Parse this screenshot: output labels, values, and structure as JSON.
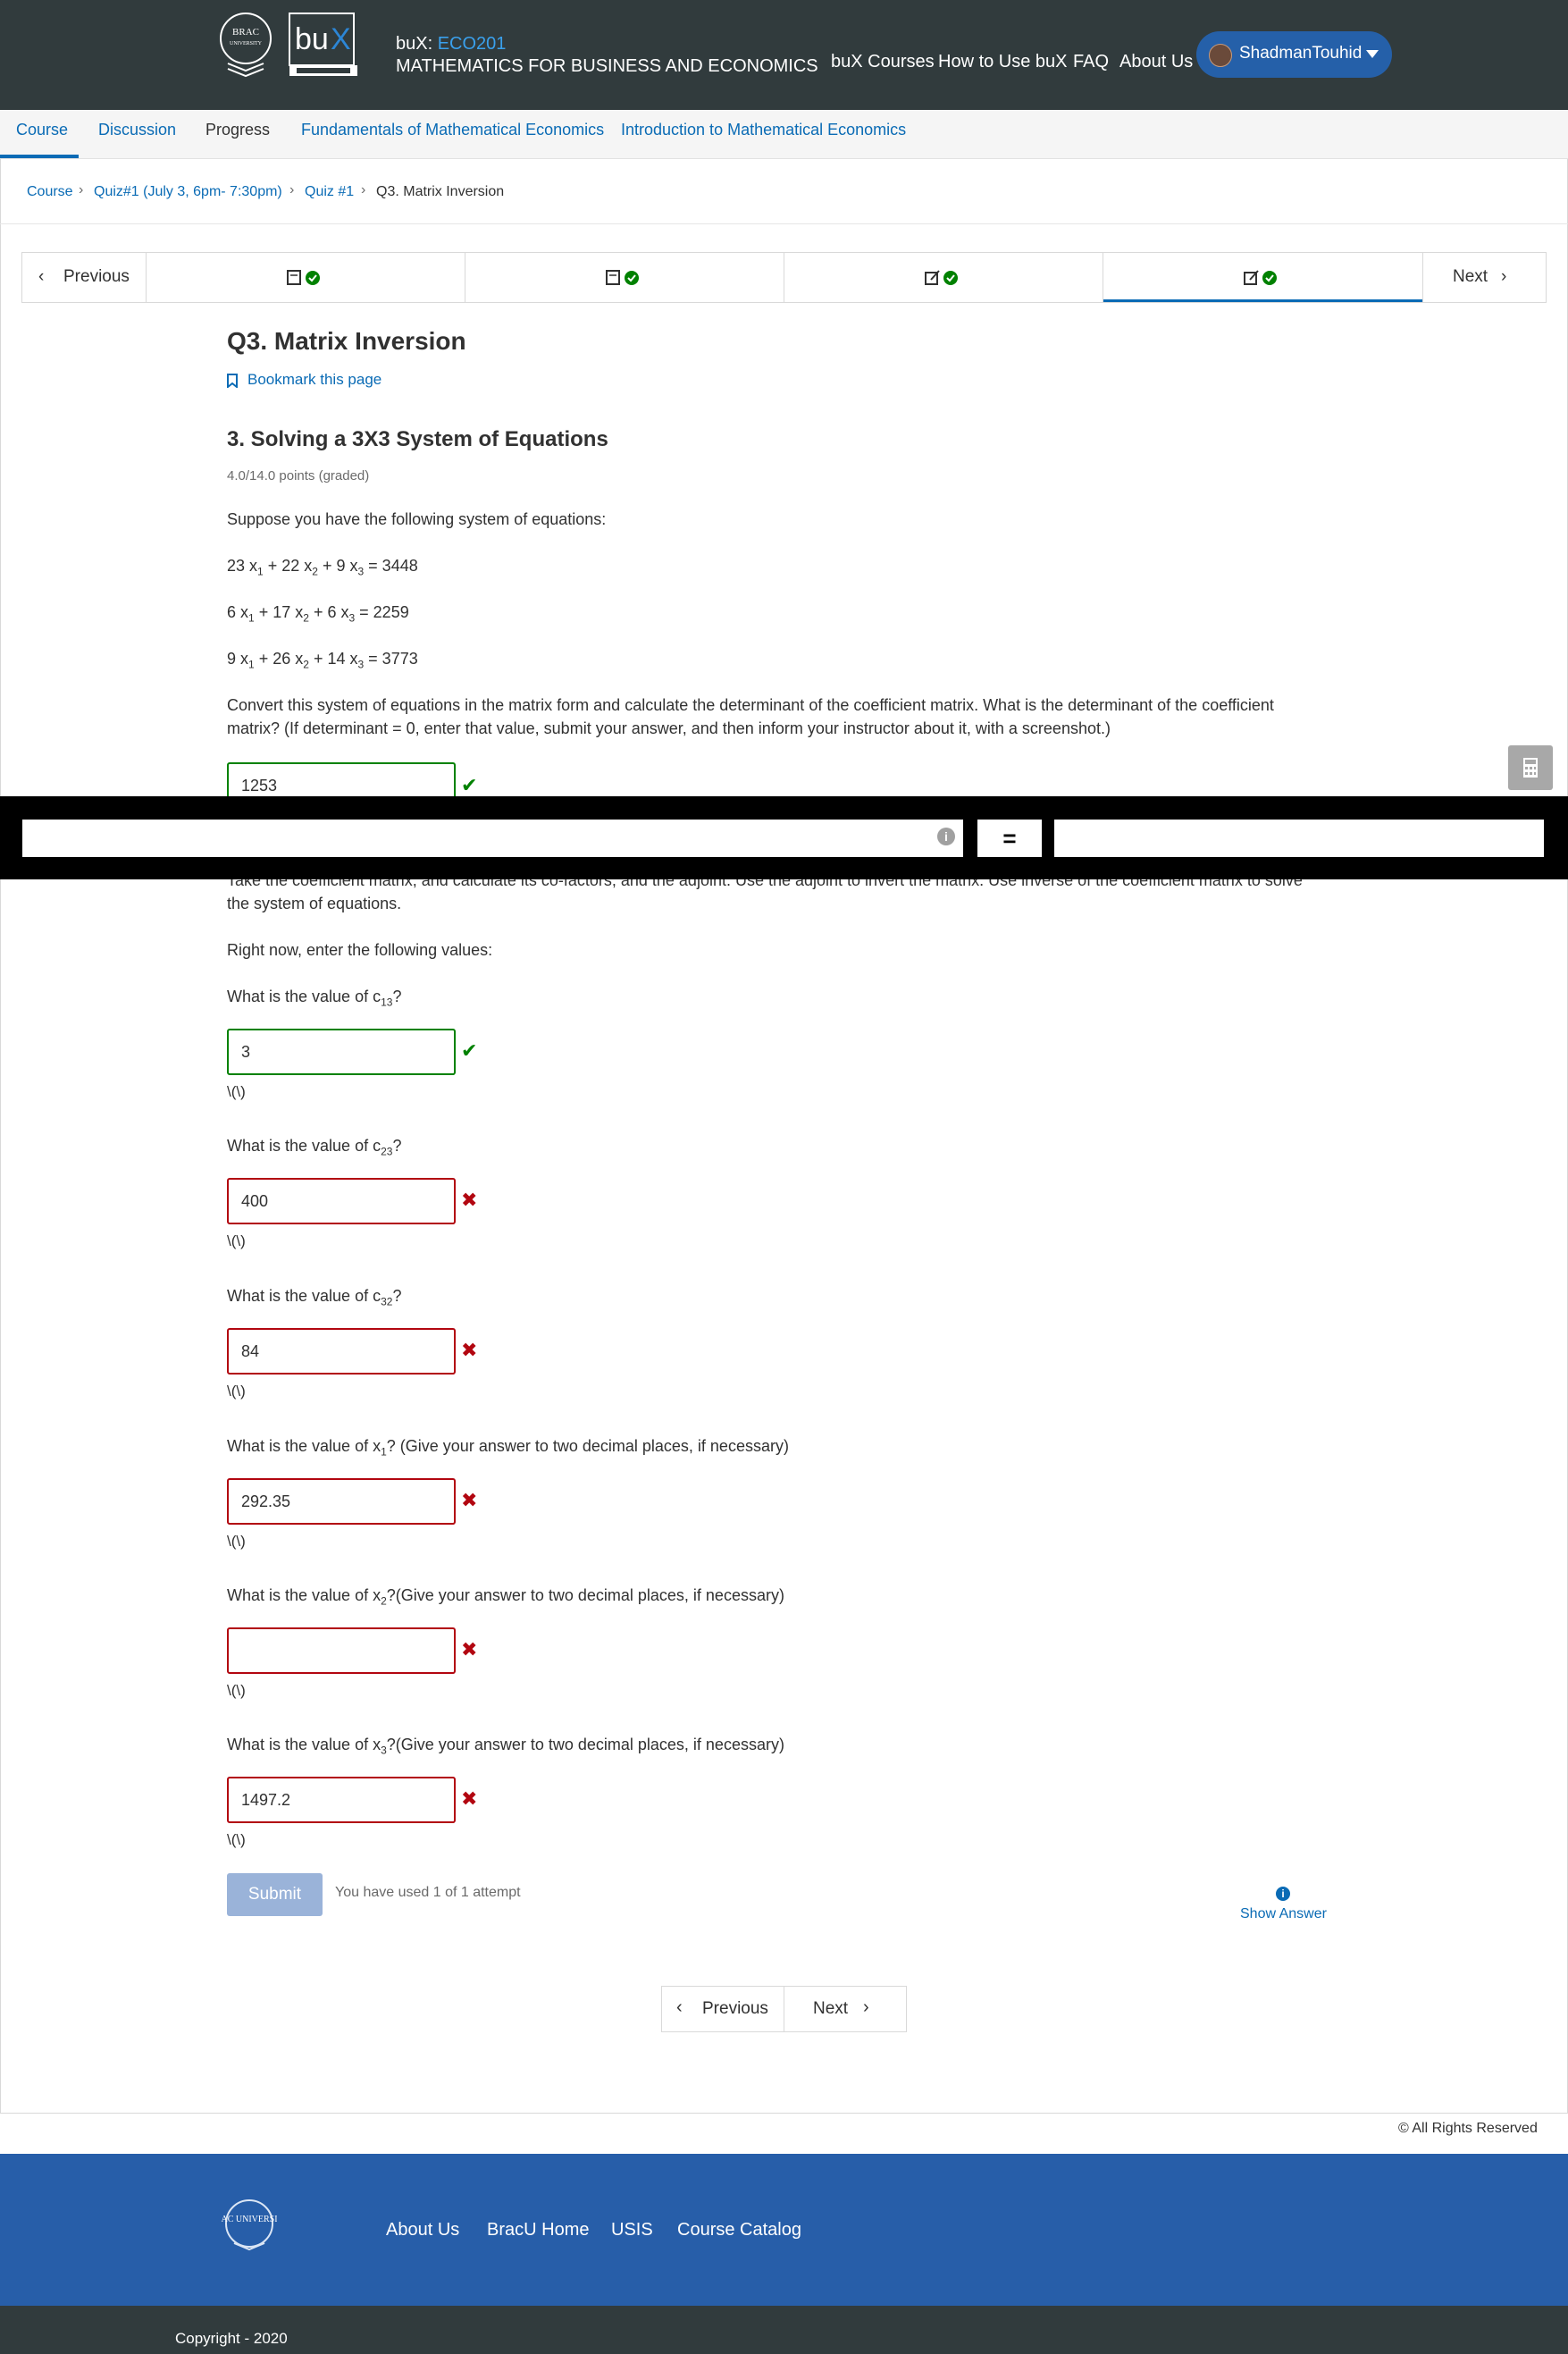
{
  "header": {
    "org_prefix": "buX: ",
    "course_code": "ECO201",
    "course_title": "MATHEMATICS FOR BUSINESS AND ECONOMICS",
    "nav": [
      "buX Courses",
      "How to Use buX",
      "FAQ",
      "About Us"
    ],
    "user_name": "ShadmanTouhid",
    "logo_brac_text": "BRAC UNIVERSITY",
    "logo_bux_text": "buX"
  },
  "course_tabs": [
    "Course",
    "Discussion",
    "Progress",
    "Fundamentals of Mathematical Economics",
    "Introduction to Mathematical Economics"
  ],
  "breadcrumb": [
    "Course",
    "Quiz#1 (July 3, 6pm- 7:30pm)",
    "Quiz #1",
    "Q3. Matrix Inversion"
  ],
  "sequence": {
    "previous": "Previous",
    "next": "Next"
  },
  "problem": {
    "unit_title": "Q3. Matrix Inversion",
    "bookmark": "Bookmark this page",
    "title": "3. Solving a 3X3 System of Equations",
    "points": "4.0/14.0 points (graded)",
    "intro": "Suppose you have the following system of equations:",
    "eq1": {
      "a": "23 x",
      "b": " + 22 x",
      "c": " + 9 x",
      "rhs": " = 3448"
    },
    "eq2": {
      "a": "6 x",
      "b": " + 17 x",
      "c": " + 6 x",
      "rhs": " = 2259"
    },
    "eq3": {
      "a": "9 x",
      "b": " + 26 x",
      "c": " + 14 x",
      "rhs": " = 3773"
    },
    "det_question_line1": "Convert this system of equations in the matrix form and calculate the determinant of the coefficient matrix. What is the determinant of the coefficient",
    "det_question_line2": "matrix? (If determinant = 0, enter that value, submit your answer, and then inform your instructor about it, with a screenshot.)",
    "det_answer": "1253",
    "cofactor_instr_line1": "Take the coefficient matrix, and calculate its co-factors, and the adjoint. Use the adjoint to invert the matrix. Use inverse of the coefficient matrix to solve",
    "cofactor_instr_line2": "the system of equations.",
    "right_now": "Right now, enter the following values:",
    "q_c13_pre": "What is the value of c",
    "q_c13_sub": "13",
    "q_c23_sub": "23",
    "q_c32_sub": "32",
    "q_suffix": "?",
    "ans_c13": "3",
    "ans_c23": "400",
    "ans_c32": "84",
    "q_x1_pre": "What is the value of x",
    "q_x1_post": "? (Give your answer to two decimal places, if necessary)",
    "q_x2_post": "?(Give your answer to two decimal places, if necessary)",
    "q_x3_post": "?(Give your answer to two decimal places, if necessary)",
    "ans_x1": "292.35",
    "ans_x2": "",
    "ans_x3": "1497.2",
    "mathjax_placeholder": "\\(\\)",
    "sub1": "1",
    "sub2": "2",
    "sub3": "3",
    "submit": "Submit",
    "attempts": "You have used 1 of 1 attempt",
    "show_answer": "Show Answer"
  },
  "calculator": {
    "equals": "="
  },
  "rights": "© All Rights Reserved",
  "footer": {
    "links": [
      "About Us",
      "BracU Home",
      "USIS",
      "Course Catalog"
    ],
    "copyright": "Copyright - 2020"
  },
  "colors": {
    "header_bg": "#313b3d",
    "accent": "#0a6bb5",
    "correct": "#008100",
    "incorrect": "#b20610",
    "footer_bg": "#275ea9"
  },
  "icons": [
    "book-icon",
    "check-circle-icon",
    "edit-icon",
    "bookmark-icon",
    "calculator-icon",
    "info-icon",
    "chevron-left-icon",
    "chevron-right-icon"
  ]
}
